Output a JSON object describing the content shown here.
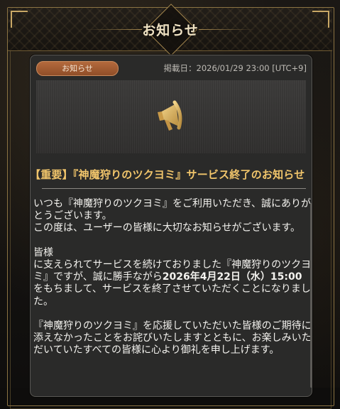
{
  "header": {
    "title": "お知らせ"
  },
  "notice": {
    "category": "お知らせ",
    "published_label": "掲載日：",
    "published_date": "2026/01/29 23:00",
    "timezone": "[UTC+9]",
    "banner_icon": "megaphone-icon",
    "title": "【重要】『神魔狩りのツクヨミ』サービス終了のお知らせ",
    "body": {
      "p1": "いつも『神魔狩りのツクヨミ』をご利用いただき、誠にありがとうございます。",
      "p2": "この度は、ユーザーの皆様に大切なお知らせがございます。",
      "p3_heading": "皆様",
      "p3_a": "に支えられてサービスを続けておりました『神魔狩りのツクヨミ』ですが、誠に勝手ながら",
      "p3_date": "2026年4月22日（水）15:00",
      "p3_b": "をもちまして、サービスを終了させていただくことになりました。",
      "p4": "『神魔狩りのツクヨミ』を応援していただいた皆様のご期待に添えなかったことをお詫びいたしますとともに、お楽しみいただいていたすべての皆様に心より御礼を申し上げます。"
    }
  },
  "colors": {
    "accent_gold": "#c9a866",
    "title_gold": "#f1c56b",
    "badge": "#a65e33",
    "card_bg": "#2a2a29"
  }
}
